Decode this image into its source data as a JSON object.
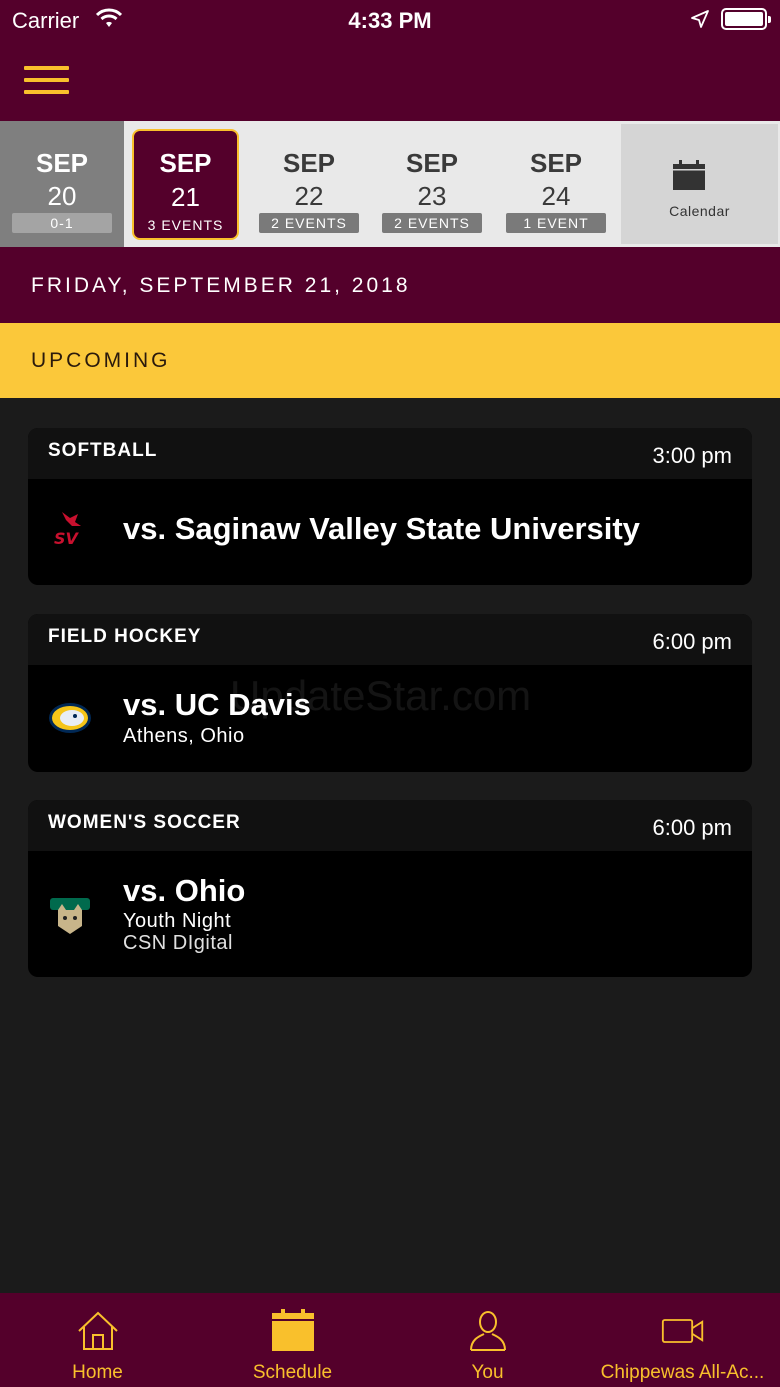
{
  "status_bar": {
    "carrier": "Carrier",
    "time": "4:33 PM"
  },
  "date_strip": {
    "days": [
      {
        "month": "SEP",
        "day": "20",
        "badge": "0-1"
      },
      {
        "month": "SEP",
        "day": "21",
        "badge": "3 EVENTS"
      },
      {
        "month": "SEP",
        "day": "22",
        "badge": "2 EVENTS"
      },
      {
        "month": "SEP",
        "day": "23",
        "badge": "2 EVENTS"
      },
      {
        "month": "SEP",
        "day": "24",
        "badge": "1 EVENT"
      }
    ],
    "calendar_label": "Calendar"
  },
  "date_heading": "FRIDAY, SEPTEMBER 21, 2018",
  "section_label": "UPCOMING",
  "events": [
    {
      "sport": "SOFTBALL",
      "time": "3:00 pm",
      "opponent": "vs. Saginaw Valley State University",
      "logo_icon": "saginaw-valley-logo-icon"
    },
    {
      "sport": "FIELD HOCKEY",
      "time": "6:00 pm",
      "opponent": "vs. UC Davis",
      "location": "Athens, Ohio",
      "logo_icon": "uc-davis-logo-icon"
    },
    {
      "sport": "WOMEN'S SOCCER",
      "time": "6:00 pm",
      "opponent": "vs. Ohio",
      "note": "Youth Night",
      "broadcast": "CSN DIgital",
      "logo_icon": "ohio-bobcats-logo-icon"
    }
  ],
  "watermark": "UpdateStar.com",
  "tab_bar": {
    "tabs": [
      {
        "label": "Home",
        "icon": "home-icon"
      },
      {
        "label": "Schedule",
        "icon": "calendar-icon"
      },
      {
        "label": "You",
        "icon": "person-icon"
      },
      {
        "label": "Chippewas All-Ac...",
        "icon": "video-camera-icon"
      }
    ]
  },
  "colors": {
    "maroon": "#54002b",
    "gold": "#f9c02c",
    "upcoming_bg": "#fbc83a",
    "background": "#1b1b1b",
    "card": "#000000"
  }
}
